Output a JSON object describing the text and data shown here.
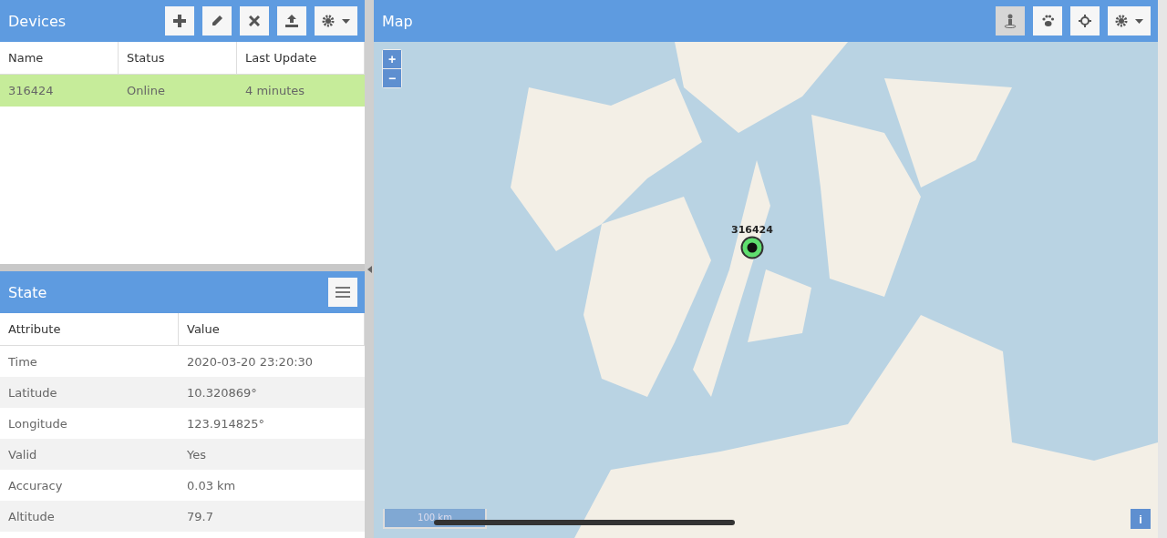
{
  "devices": {
    "title": "Devices",
    "tools": [
      {
        "kind": "add",
        "dropdown": false
      },
      {
        "kind": "edit",
        "dropdown": false
      },
      {
        "kind": "remove",
        "dropdown": false
      },
      {
        "kind": "upload",
        "dropdown": false
      },
      {
        "kind": "settings",
        "dropdown": true
      }
    ],
    "columns": [
      "Name",
      "Status",
      "Last Update"
    ],
    "rows": [
      {
        "name": "316424",
        "status": "Online",
        "last_update": "4 minutes",
        "selected": true
      }
    ]
  },
  "state": {
    "title": "State",
    "columns": [
      "Attribute",
      "Value"
    ],
    "rows": [
      {
        "attribute": "Time",
        "value": "2020-03-20 23:20:30"
      },
      {
        "attribute": "Latitude",
        "value": "10.320869°"
      },
      {
        "attribute": "Longitude",
        "value": "123.914825°"
      },
      {
        "attribute": "Valid",
        "value": "Yes"
      },
      {
        "attribute": "Accuracy",
        "value": "0.03 km"
      },
      {
        "attribute": "Altitude",
        "value": "79.7"
      }
    ]
  },
  "map": {
    "title": "Map",
    "tools": [
      {
        "kind": "person",
        "on": true,
        "dropdown": false
      },
      {
        "kind": "paw",
        "on": false,
        "dropdown": false
      },
      {
        "kind": "locate",
        "on": false,
        "dropdown": false
      },
      {
        "kind": "settings",
        "on": false,
        "dropdown": true
      }
    ],
    "zoom": [
      "+",
      "−"
    ],
    "marker": {
      "label": "316424"
    },
    "scale": "100 km",
    "info": "i"
  }
}
